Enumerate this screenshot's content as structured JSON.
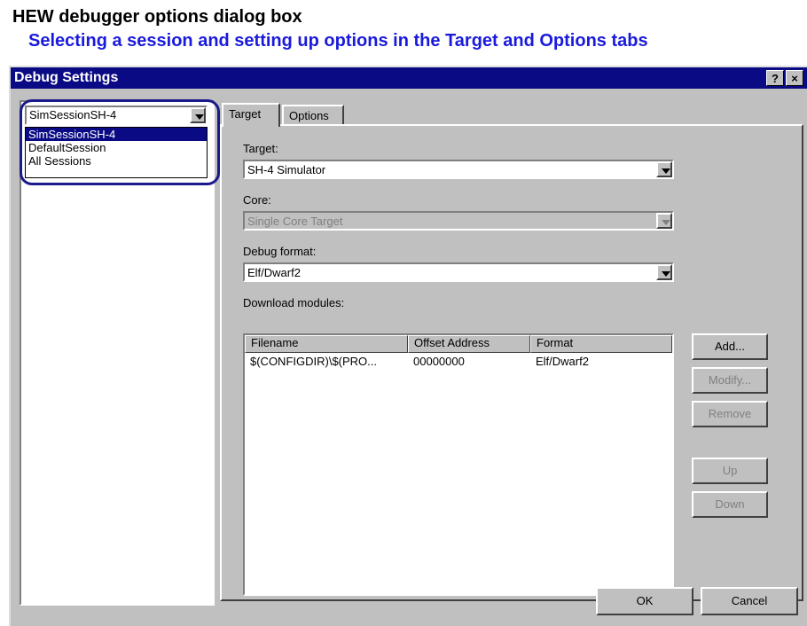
{
  "caption": {
    "title": "HEW debugger options dialog box",
    "subtitle": "Selecting a session and setting up options in the Target and Options tabs"
  },
  "dialog": {
    "title": "Debug Settings",
    "help_glyph": "?",
    "close_glyph": "×"
  },
  "session": {
    "selected": "SimSessionSH-4",
    "items": [
      "SimSessionSH-4",
      "DefaultSession",
      "All Sessions"
    ]
  },
  "tabs": [
    {
      "label": "Target",
      "active": true
    },
    {
      "label": "Options",
      "active": false
    }
  ],
  "target_tab": {
    "target_label": "Target:",
    "target_value": "SH-4 Simulator",
    "core_label": "Core:",
    "core_value": "Single Core Target",
    "debug_format_label": "Debug format:",
    "debug_format_value": "Elf/Dwarf2",
    "download_modules_label": "Download modules:",
    "columns": [
      "Filename",
      "Offset Address",
      "Format"
    ],
    "rows": [
      {
        "filename": "$(CONFIGDIR)\\$(PRO...",
        "offset": "00000000",
        "format": "Elf/Dwarf2"
      }
    ],
    "buttons": {
      "add": "Add...",
      "modify": "Modify...",
      "remove": "Remove",
      "up": "Up",
      "down": "Down"
    }
  },
  "footer": {
    "ok": "OK",
    "cancel": "Cancel"
  },
  "colors": {
    "titlebar": "#0a0a84",
    "dialog_face": "#c0c0c0",
    "subtitle": "#1a1adc",
    "session_ring": "#1a1a8a"
  }
}
